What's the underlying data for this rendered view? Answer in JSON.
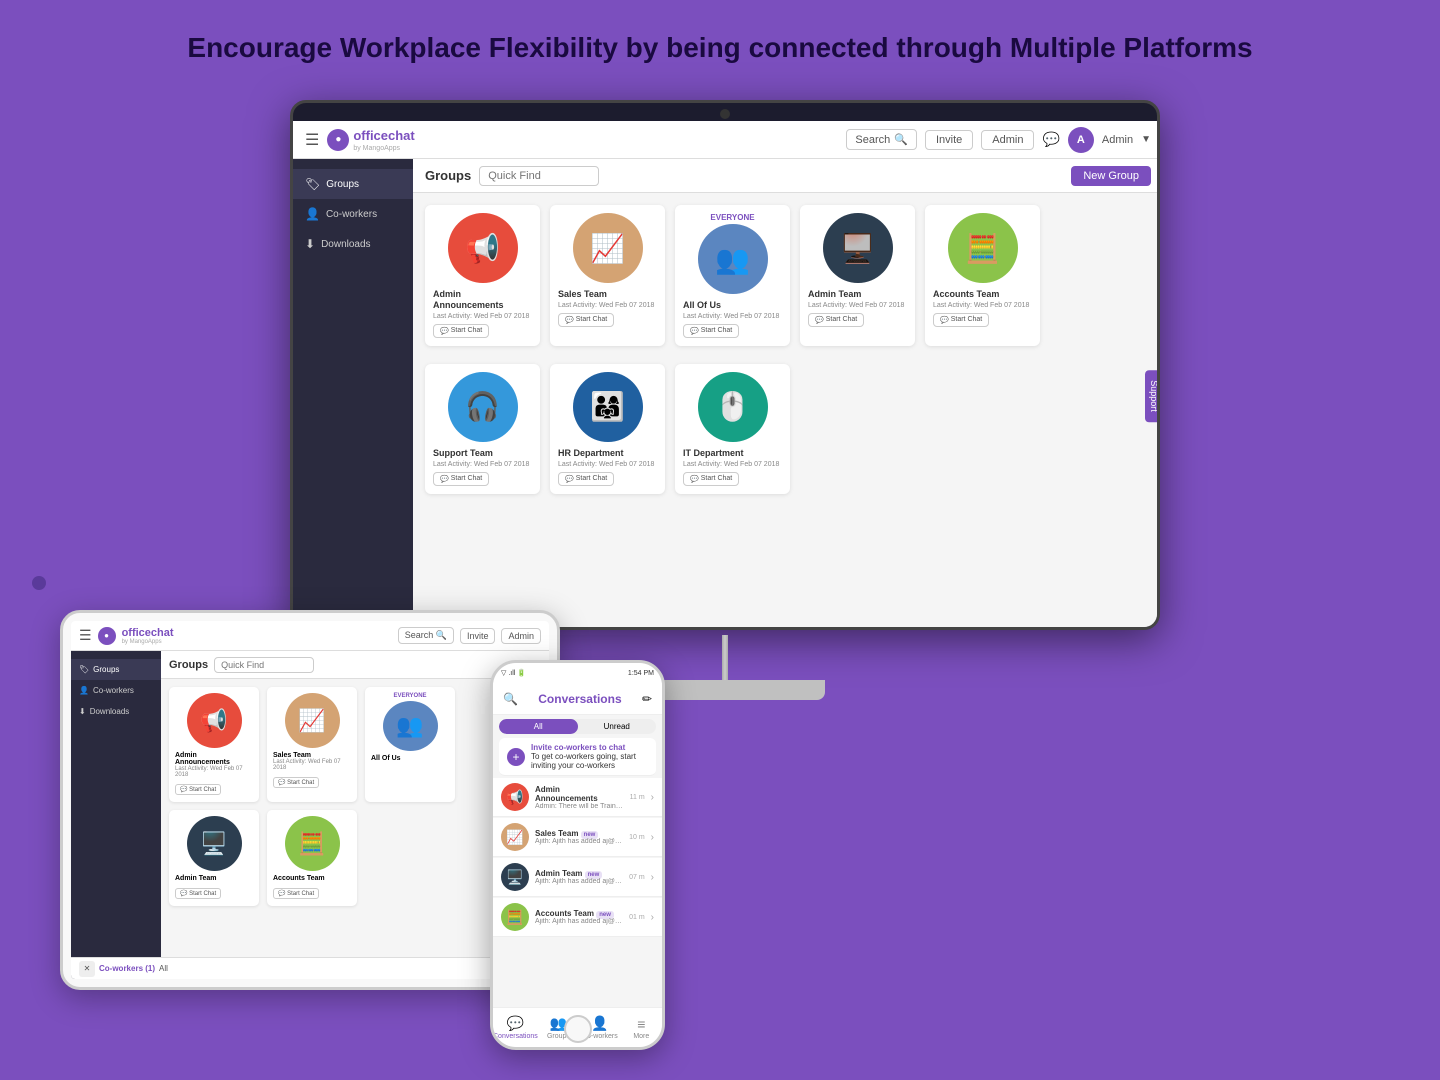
{
  "page": {
    "background": "#7B4FBE",
    "headline": "Encourage Workplace Flexibility by being connected through Multiple Platforms"
  },
  "monitor": {
    "topbar": {
      "menu_icon": "☰",
      "logo_text": "officechat",
      "logo_sub": "by MangoApps",
      "search_label": "Search",
      "invite_label": "Invite",
      "admin_label": "Admin",
      "admin_avatar": "A",
      "admin_name": "Admin",
      "chat_icon": "💬"
    },
    "sidebar": {
      "groups_label": "Groups",
      "coworkers_label": "Co-workers",
      "downloads_label": "Downloads"
    },
    "content": {
      "title": "Groups",
      "quick_find_placeholder": "Quick Find",
      "new_group_label": "New Group",
      "support_tab": "Support"
    },
    "groups": [
      {
        "name": "Admin Announcements",
        "last_activity": "Last Activity: Wed Feb 07 2018",
        "start_chat": "Start Chat",
        "icon_color": "#e74c3c",
        "icon_char": "📢"
      },
      {
        "name": "Sales Team",
        "last_activity": "Last Activity: Wed Feb 07 2018",
        "start_chat": "Start Chat",
        "icon_color": "#b5651d",
        "icon_char": "📈"
      },
      {
        "name": "All Of Us",
        "last_activity": "Last Activity: Wed Feb 07 2018",
        "start_chat": "Start Chat",
        "icon_color": "#3498db",
        "icon_char": "👥",
        "special": "EVERYONE"
      },
      {
        "name": "Admin Team",
        "last_activity": "Last Activity: Wed Feb 07 2018",
        "start_chat": "Start Chat",
        "icon_color": "#2c3e50",
        "icon_char": "🖥️"
      },
      {
        "name": "Accounts Team",
        "last_activity": "Last Activity: Wed Feb 07 2018",
        "start_chat": "Start Chat",
        "icon_color": "#27ae60",
        "icon_char": "🧮"
      },
      {
        "name": "Support Team",
        "last_activity": "Last Activity: Wed Feb 07 2018",
        "start_chat": "Start Chat",
        "icon_color": "#3498db",
        "icon_char": "🎧"
      },
      {
        "name": "HR Department",
        "last_activity": "Last Activity: Wed Feb 07 2018",
        "start_chat": "Start Chat",
        "icon_color": "#2c6fad",
        "icon_char": "👨‍👩‍👧"
      },
      {
        "name": "IT Department",
        "last_activity": "Last Activity: Wed Feb 07 2018",
        "start_chat": "Start Chat",
        "icon_color": "#16a085",
        "icon_char": "🖱️"
      }
    ]
  },
  "tablet": {
    "logo_text": "officechat",
    "search_label": "Search",
    "invite_label": "Invite",
    "admin_label": "Admin",
    "groups_label": "Groups",
    "coworkers_label": "Co-workers",
    "downloads_label": "Downloads",
    "content_title": "Groups",
    "quick_find_placeholder": "Quick Find",
    "coworkers_tab": "Co-workers (1)",
    "footer_items": [
      "Co-workers (1)",
      "All"
    ]
  },
  "phone": {
    "status_bar": {
      "time": "1:54 PM",
      "signal": "▂▄▆",
      "battery": "■"
    },
    "title": "Conversations",
    "edit_label": "✏",
    "filter_all": "All",
    "filter_unread": "Unread",
    "invite_title": "Invite co-workers to chat",
    "invite_sub": "To get co-workers going, start inviting your co-workers",
    "conversations": [
      {
        "name": "Admin Announcements",
        "preview": "Admin: There will be Training Session Scheduler for all employees today at...",
        "time": "11 m",
        "icon_color": "#e74c3c",
        "icon_char": "📢"
      },
      {
        "name": "Sales Team",
        "preview": "Ajith: Ajith has added aj@@mangospring.com...",
        "time": "10 m",
        "icon_color": "#b5651d",
        "icon_char": "📈"
      },
      {
        "name": "Admin Team",
        "preview": "Ajith: Ajith has added aj@mangospring.com...",
        "time": "07 m",
        "icon_color": "#2c3e50",
        "icon_char": "🖥️"
      },
      {
        "name": "Accounts Team",
        "preview": "Ajith: Ajith has added aj@@mangospring.com...",
        "time": "01 m",
        "icon_color": "#27ae60",
        "icon_char": "🧮"
      }
    ],
    "nav": [
      {
        "label": "Conversations",
        "icon": "💬",
        "active": true
      },
      {
        "label": "Groups",
        "icon": "👥",
        "active": false
      },
      {
        "label": "Co-workers",
        "icon": "👤",
        "active": false
      },
      {
        "label": "More",
        "icon": "≡",
        "active": false
      }
    ]
  }
}
